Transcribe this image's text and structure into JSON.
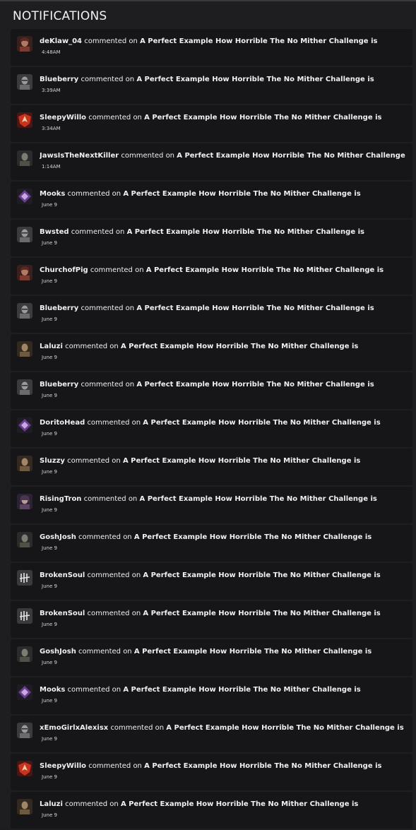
{
  "header": {
    "title": "NOTIFICATIONS"
  },
  "notifications": [
    {
      "user": "deKlaw_04",
      "action": "commented on",
      "post": "A Perfect Example How Horrible The No Mither Challenge is",
      "time": "4:48AM",
      "avatar": "portrait-red"
    },
    {
      "user": "Blueberry",
      "action": "commented on",
      "post": "A Perfect Example How Horrible The No Mither Challenge is",
      "time": "3:39AM",
      "avatar": "portrait-gray"
    },
    {
      "user": "SleepyWillo",
      "action": "commented on",
      "post": "A Perfect Example How Horrible The No Mither Challenge is",
      "time": "3:34AM",
      "avatar": "red-badge"
    },
    {
      "user": "JawsIsTheNextKiller",
      "action": "commented on",
      "post": "A Perfect Example How Horrible The No Mither Challenge is",
      "time": "1:14AM",
      "avatar": "portrait-dark"
    },
    {
      "user": "Mooks",
      "action": "commented on",
      "post": "A Perfect Example How Horrible The No Mither Challenge is",
      "time": "June 9",
      "avatar": "purple-diamond"
    },
    {
      "user": "Bwsted",
      "action": "commented on",
      "post": "A Perfect Example How Horrible The No Mither Challenge is",
      "time": "June 9",
      "avatar": "portrait-gray"
    },
    {
      "user": "ChurchofPig",
      "action": "commented on",
      "post": "A Perfect Example How Horrible The No Mither Challenge is",
      "time": "June 9",
      "avatar": "portrait-red"
    },
    {
      "user": "Blueberry",
      "action": "commented on",
      "post": "A Perfect Example How Horrible The No Mither Challenge is",
      "time": "June 9",
      "avatar": "portrait-gray"
    },
    {
      "user": "Laluzi",
      "action": "commented on",
      "post": "A Perfect Example How Horrible The No Mither Challenge is",
      "time": "June 9",
      "avatar": "portrait-brown"
    },
    {
      "user": "Blueberry",
      "action": "commented on",
      "post": "A Perfect Example How Horrible The No Mither Challenge is",
      "time": "June 9",
      "avatar": "portrait-gray"
    },
    {
      "user": "DoritoHead",
      "action": "commented on",
      "post": "A Perfect Example How Horrible The No Mither Challenge is",
      "time": "June 9",
      "avatar": "purple-diamond"
    },
    {
      "user": "Sluzzy",
      "action": "commented on",
      "post": "A Perfect Example How Horrible The No Mither Challenge is",
      "time": "June 9",
      "avatar": "portrait-brown"
    },
    {
      "user": "RisingTron",
      "action": "commented on",
      "post": "A Perfect Example How Horrible The No Mither Challenge is",
      "time": "June 9",
      "avatar": "portrait-purple"
    },
    {
      "user": "GoshJosh",
      "action": "commented on",
      "post": "A Perfect Example How Horrible The No Mither Challenge is",
      "time": "June 9",
      "avatar": "portrait-dark"
    },
    {
      "user": "BrokenSoul",
      "action": "commented on",
      "post": "A Perfect Example How Horrible The No Mither Challenge is",
      "time": "June 9",
      "avatar": "dbd-logo"
    },
    {
      "user": "BrokenSoul",
      "action": "commented on",
      "post": "A Perfect Example How Horrible The No Mither Challenge is",
      "time": "June 9",
      "avatar": "dbd-logo"
    },
    {
      "user": "GoshJosh",
      "action": "commented on",
      "post": "A Perfect Example How Horrible The No Mither Challenge is",
      "time": "June 9",
      "avatar": "portrait-dark"
    },
    {
      "user": "Mooks",
      "action": "commented on",
      "post": "A Perfect Example How Horrible The No Mither Challenge is",
      "time": "June 9",
      "avatar": "purple-diamond"
    },
    {
      "user": "xEmoGirlxAlexisx",
      "action": "commented on",
      "post": "A Perfect Example How Horrible The No Mither Challenge is",
      "time": "June 9",
      "avatar": "portrait-gray"
    },
    {
      "user": "SleepyWillo",
      "action": "commented on",
      "post": "A Perfect Example How Horrible The No Mither Challenge is",
      "time": "June 9",
      "avatar": "red-badge"
    },
    {
      "user": "Laluzi",
      "action": "commented on",
      "post": "A Perfect Example How Horrible The No Mither Challenge is",
      "time": "June 9",
      "avatar": "portrait-brown"
    }
  ]
}
